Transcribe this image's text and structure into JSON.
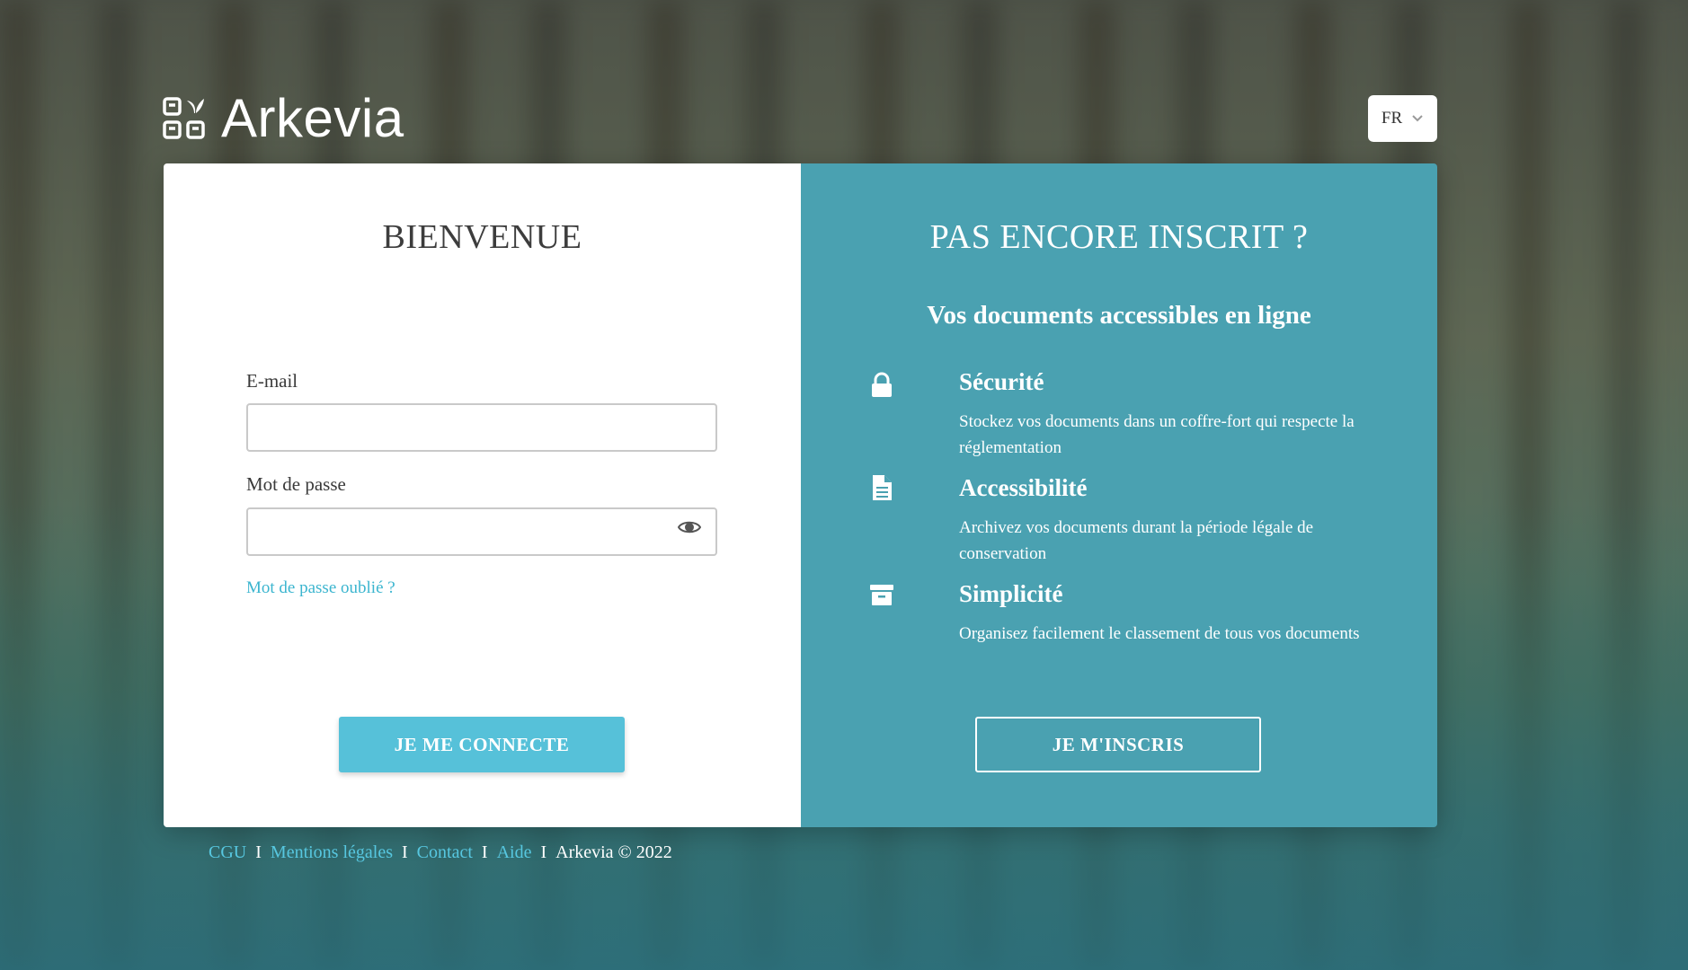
{
  "brand": {
    "name": "Arkevia"
  },
  "language": {
    "selected": "FR"
  },
  "login": {
    "title": "BIENVENUE",
    "email_label": "E-mail",
    "email_value": "",
    "password_label": "Mot de passe",
    "password_value": "",
    "forgot_link": "Mot de passe oublié ?",
    "submit_label": "JE ME CONNECTE"
  },
  "signup": {
    "title": "PAS ENCORE INSCRIT ?",
    "subtitle": "Vos documents accessibles en ligne",
    "features": [
      {
        "icon": "lock-icon",
        "title": "Sécurité",
        "desc": "Stockez vos documents dans un coffre-fort qui respecte la réglementation"
      },
      {
        "icon": "document-icon",
        "title": "Accessibilité",
        "desc": "Archivez vos documents durant la période légale de conservation"
      },
      {
        "icon": "archive-box-icon",
        "title": "Simplicité",
        "desc": "Organisez facilement le classement de tous vos documents"
      }
    ],
    "submit_label": "JE M'INSCRIS"
  },
  "footer": {
    "links": [
      "CGU",
      "Mentions légales",
      "Contact",
      "Aide"
    ],
    "separator": "I",
    "copyright": "Arkevia © 2022"
  },
  "colors": {
    "accent": "#56c1d9",
    "panel": "#4aa1b1",
    "link": "#3bb5cf"
  }
}
